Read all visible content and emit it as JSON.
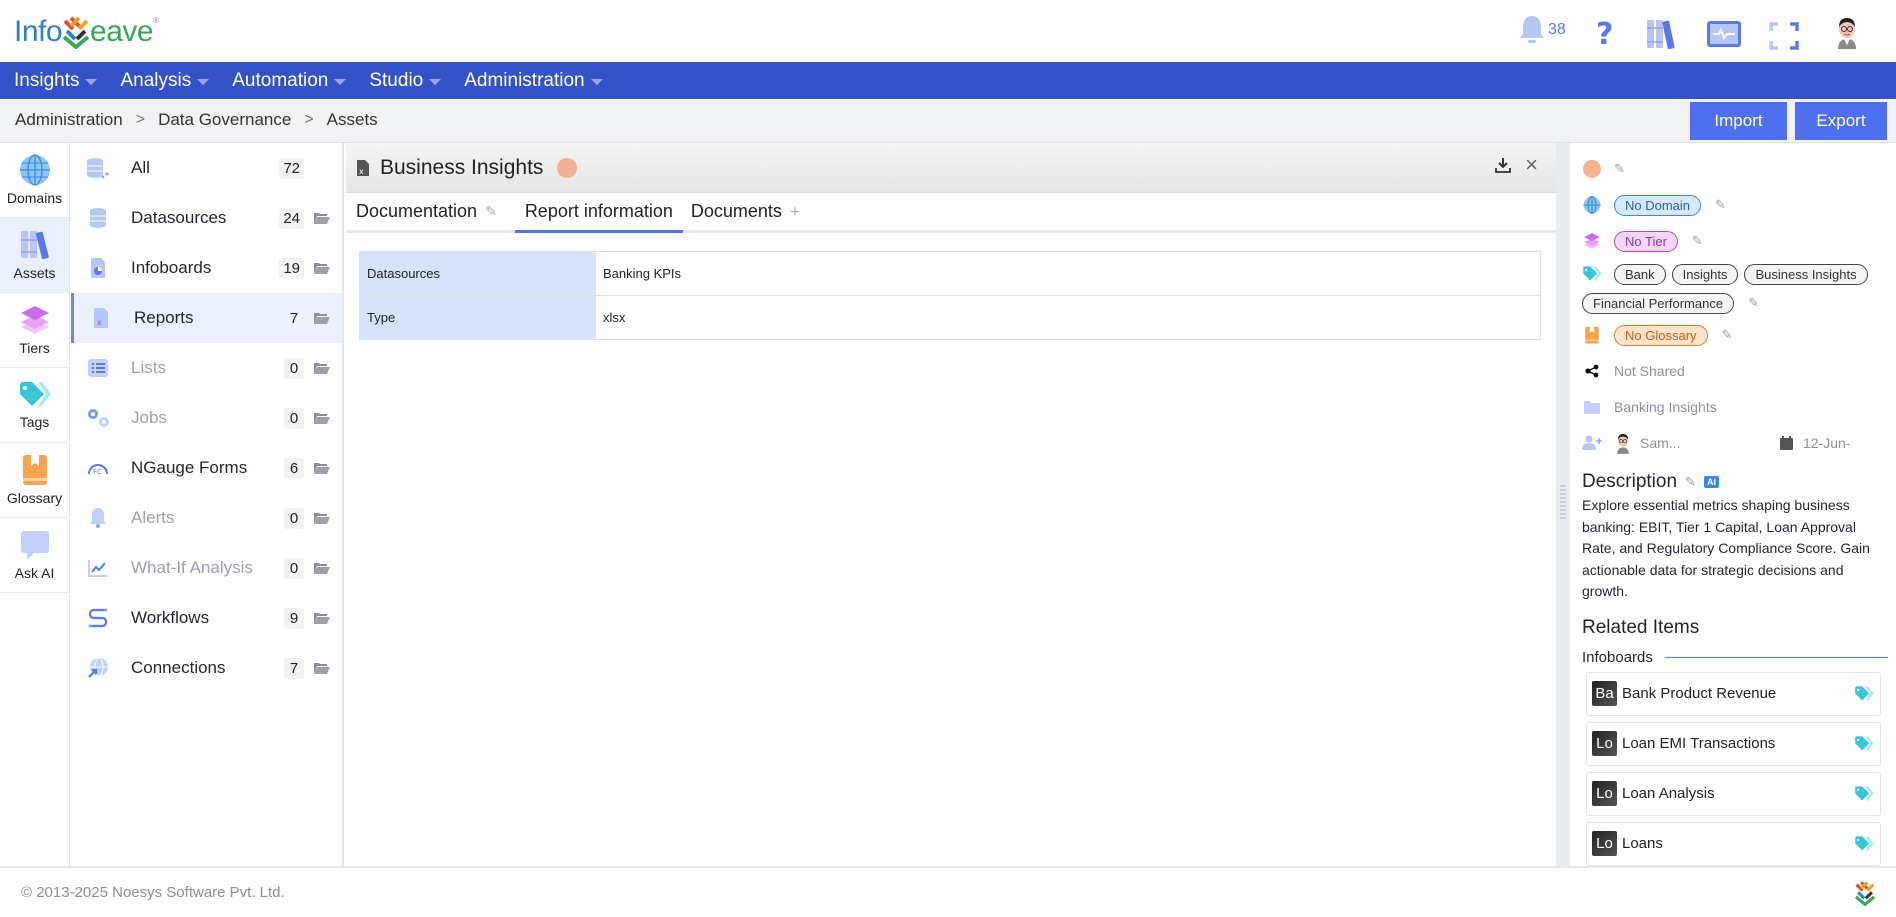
{
  "app": {
    "logo_left": "Info",
    "logo_right": "eave",
    "logo_reg": "®",
    "notification_count": "38"
  },
  "nav": {
    "items": [
      {
        "label": "Insights"
      },
      {
        "label": "Analysis"
      },
      {
        "label": "Automation"
      },
      {
        "label": "Studio"
      },
      {
        "label": "Administration"
      }
    ]
  },
  "breadcrumb": {
    "items": [
      "Administration",
      "Data Governance",
      "Assets"
    ],
    "separator": ">"
  },
  "toolbar": {
    "import_label": "Import",
    "export_label": "Export"
  },
  "iconbar": {
    "items": [
      {
        "label": "Domains",
        "icon": "globe-icon"
      },
      {
        "label": "Assets",
        "icon": "books-icon",
        "active": true
      },
      {
        "label": "Tiers",
        "icon": "layers-icon"
      },
      {
        "label": "Tags",
        "icon": "tag-icon"
      },
      {
        "label": "Glossary",
        "icon": "book-icon"
      },
      {
        "label": "Ask AI",
        "icon": "chat-icon"
      }
    ]
  },
  "categories": [
    {
      "label": "All",
      "count": "72",
      "icon": "database-all-icon",
      "folder": false
    },
    {
      "label": "Datasources",
      "count": "24",
      "icon": "database-icon",
      "folder": true
    },
    {
      "label": "Infoboards",
      "count": "19",
      "icon": "infoboard-icon",
      "folder": true
    },
    {
      "label": "Reports",
      "count": "7",
      "icon": "report-icon",
      "folder": true,
      "active": true
    },
    {
      "label": "Lists",
      "count": "0",
      "icon": "list-icon",
      "folder": true,
      "muted": true
    },
    {
      "label": "Jobs",
      "count": "0",
      "icon": "gears-icon",
      "folder": true,
      "muted": true
    },
    {
      "label": "NGauge Forms",
      "count": "6",
      "icon": "gauge-icon",
      "folder": true
    },
    {
      "label": "Alerts",
      "count": "0",
      "icon": "bell-icon",
      "folder": true,
      "muted": true
    },
    {
      "label": "What-If Analysis",
      "count": "0",
      "icon": "trend-icon",
      "folder": true,
      "muted": true
    },
    {
      "label": "Workflows",
      "count": "9",
      "icon": "workflow-icon",
      "folder": true
    },
    {
      "label": "Connections",
      "count": "7",
      "icon": "connection-icon",
      "folder": true
    }
  ],
  "panel": {
    "title": "Business Insights",
    "tabs": [
      {
        "label": "Documentation",
        "extra": "✎"
      },
      {
        "label": "Report information",
        "active": true
      },
      {
        "label": "Documents",
        "extra": "+"
      }
    ],
    "info_rows": [
      {
        "key": "Datasources",
        "value": "Banking KPIs"
      },
      {
        "key": "Type",
        "value": "xlsx"
      }
    ]
  },
  "details": {
    "domain": "No Domain",
    "tier": "No Tier",
    "tags": [
      "Bank",
      "Insights",
      "Business Insights",
      "Financial Performance"
    ],
    "glossary": "No Glossary",
    "sharing": "Not Shared",
    "folder": "Banking Insights",
    "owner": "Sam...",
    "date": "12-Jun-",
    "description_title": "Description",
    "ai_label": "AI",
    "description": "Explore essential metrics shaping business banking: EBIT, Tier 1 Capital, Loan Approval Rate, and Regulatory Compliance Score. Gain actionable data for strategic decisions and growth.",
    "related_title": "Related Items",
    "related_section": "Infoboards",
    "related_items": [
      {
        "abbr": "Ba",
        "name": "Bank Product Revenue"
      },
      {
        "abbr": "Lo",
        "name": "Loan EMI Transactions"
      },
      {
        "abbr": "Lo",
        "name": "Loan Analysis"
      },
      {
        "abbr": "Lo",
        "name": "Loans"
      }
    ]
  },
  "footer": {
    "copyright": "© 2013-2025 Noesys Software Pvt. Ltd."
  },
  "colors": {
    "nav_bg": "#3650c6",
    "accent": "#4e6ff0",
    "active_tab": "#5472e6"
  }
}
